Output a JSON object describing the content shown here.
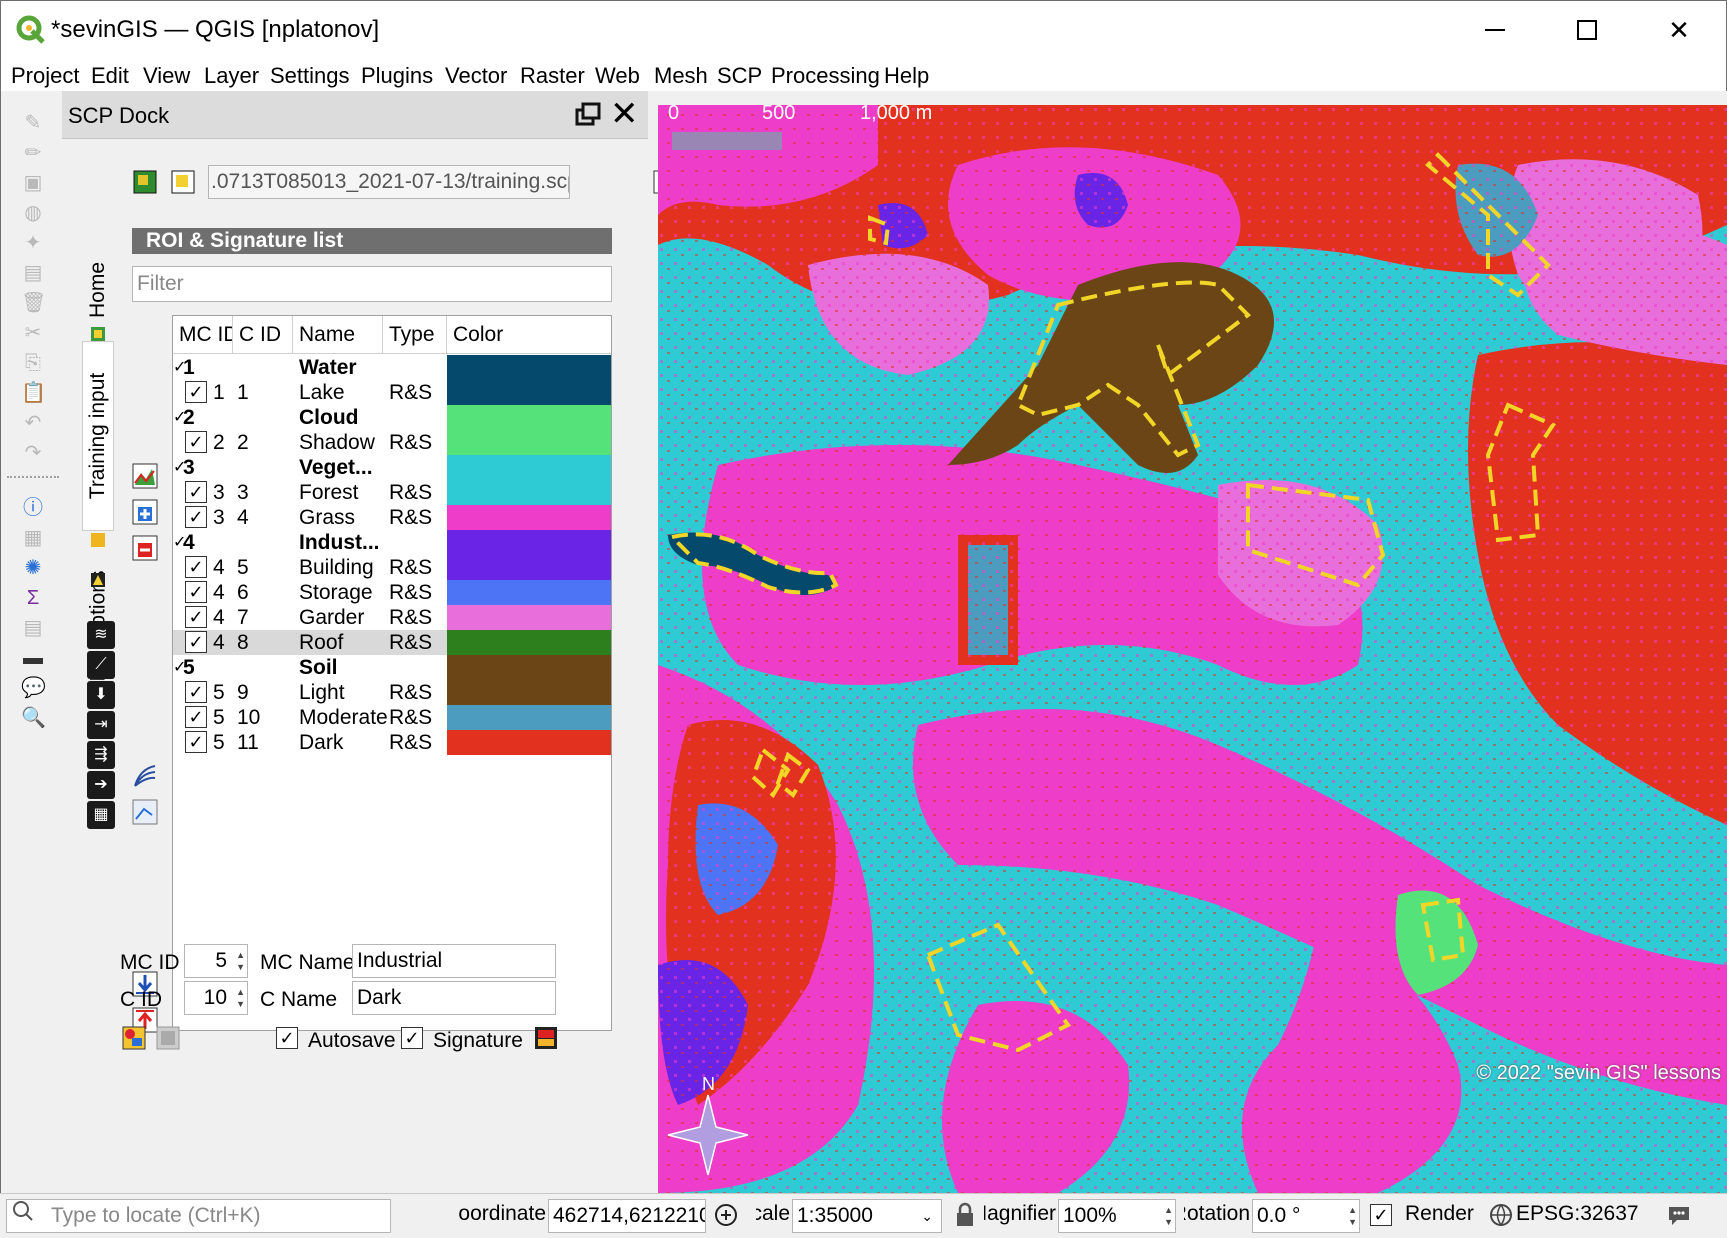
{
  "window": {
    "title": "*sevinGIS — QGIS [nplatonov]"
  },
  "menu": [
    "Project",
    "Edit",
    "View",
    "Layer",
    "Settings",
    "Plugins",
    "Vector",
    "Raster",
    "Web",
    "Mesh",
    "SCP",
    "Processing",
    "Help"
  ],
  "dock": {
    "title": "SCP Dock",
    "tabs": [
      "Home",
      "Training input",
      "ROI options"
    ],
    "file_path": ".0713T085013_2021-07-13/training.scp",
    "section_title": "ROI & Signature list",
    "filter_placeholder": "Filter",
    "columns": [
      "MC ID",
      "C ID",
      "Name",
      "Type",
      "Color"
    ],
    "rows": [
      {
        "kind": "mc",
        "mc_id": "1",
        "c_id": "",
        "name": "Water",
        "type": "",
        "color": "#054a6c",
        "checked": true
      },
      {
        "kind": "c",
        "mc_id": "1",
        "c_id": "1",
        "name": "Lake",
        "type": "R&S",
        "color": "#054a6c",
        "checked": true
      },
      {
        "kind": "mc",
        "mc_id": "2",
        "c_id": "",
        "name": "Cloud",
        "type": "",
        "color": "#55e27a",
        "checked": true
      },
      {
        "kind": "c",
        "mc_id": "2",
        "c_id": "2",
        "name": "Shadow",
        "type": "R&S",
        "color": "#55e27a",
        "checked": true
      },
      {
        "kind": "mc",
        "mc_id": "3",
        "c_id": "",
        "name": "Veget...",
        "type": "",
        "color": "#2ecbd4",
        "checked": true
      },
      {
        "kind": "c",
        "mc_id": "3",
        "c_id": "3",
        "name": "Forest",
        "type": "R&S",
        "color": "#2ecbd4",
        "checked": true
      },
      {
        "kind": "c",
        "mc_id": "3",
        "c_id": "4",
        "name": "Grass",
        "type": "R&S",
        "color": "#ee3dc8",
        "checked": true
      },
      {
        "kind": "mc",
        "mc_id": "4",
        "c_id": "",
        "name": "Indust...",
        "type": "",
        "color": "#6a24e6",
        "checked": true
      },
      {
        "kind": "c",
        "mc_id": "4",
        "c_id": "5",
        "name": "Building",
        "type": "R&S",
        "color": "#6a24e6",
        "checked": true
      },
      {
        "kind": "c",
        "mc_id": "4",
        "c_id": "6",
        "name": "Storage",
        "type": "R&S",
        "color": "#4d74f5",
        "checked": true
      },
      {
        "kind": "c",
        "mc_id": "4",
        "c_id": "7",
        "name": "Garder",
        "type": "R&S",
        "color": "#e86edc",
        "checked": true
      },
      {
        "kind": "c",
        "mc_id": "4",
        "c_id": "8",
        "name": "Roof",
        "type": "R&S",
        "color": "#2d7f1e",
        "checked": true,
        "selected": true
      },
      {
        "kind": "mc",
        "mc_id": "5",
        "c_id": "",
        "name": "Soil",
        "type": "",
        "color": "#6b4516",
        "checked": true
      },
      {
        "kind": "c",
        "mc_id": "5",
        "c_id": "9",
        "name": "Light",
        "type": "R&S",
        "color": "#6b4516",
        "checked": true
      },
      {
        "kind": "c",
        "mc_id": "5",
        "c_id": "10",
        "name": "Moderate",
        "type": "R&S",
        "color": "#4c9cbf",
        "checked": true
      },
      {
        "kind": "c",
        "mc_id": "5",
        "c_id": "11",
        "name": "Dark",
        "type": "R&S",
        "color": "#e3311f",
        "checked": true
      }
    ],
    "form": {
      "mc_id_label": "MC ID",
      "mc_id_value": "5",
      "mc_name_label": "MC Name",
      "mc_name_value": "Industrial",
      "c_id_label": "C ID",
      "c_id_value": "10",
      "c_name_label": "C Name",
      "c_name_value": "Dark",
      "autosave_label": "Autosave",
      "autosave_checked": true,
      "signature_label": "Signature",
      "signature_checked": true
    }
  },
  "map": {
    "scalebar": {
      "labels": [
        "0",
        "500",
        "1,000 m"
      ]
    },
    "copyright": "© 2022 \"sevin GIS\" lessons",
    "north_label": "N"
  },
  "status": {
    "locate_placeholder": "Type to locate (Ctrl+K)",
    "coordinate_label": "Coordinate",
    "coordinate_value": "462714,6212210",
    "scale_label": "Scale",
    "scale_value": "1:35000",
    "magnifier_label": "Magnifier",
    "magnifier_value": "100%",
    "rotation_label": "Rotation",
    "rotation_value": "0.0 °",
    "render_label": "Render",
    "render_checked": true,
    "crs": "EPSG:32637"
  },
  "colors": {
    "forest": "#2ecbd4",
    "grass": "#ee3dc8",
    "dark_soil": "#e3311f",
    "light_soil": "#6b4516",
    "roi_outline": "#f1d627"
  }
}
